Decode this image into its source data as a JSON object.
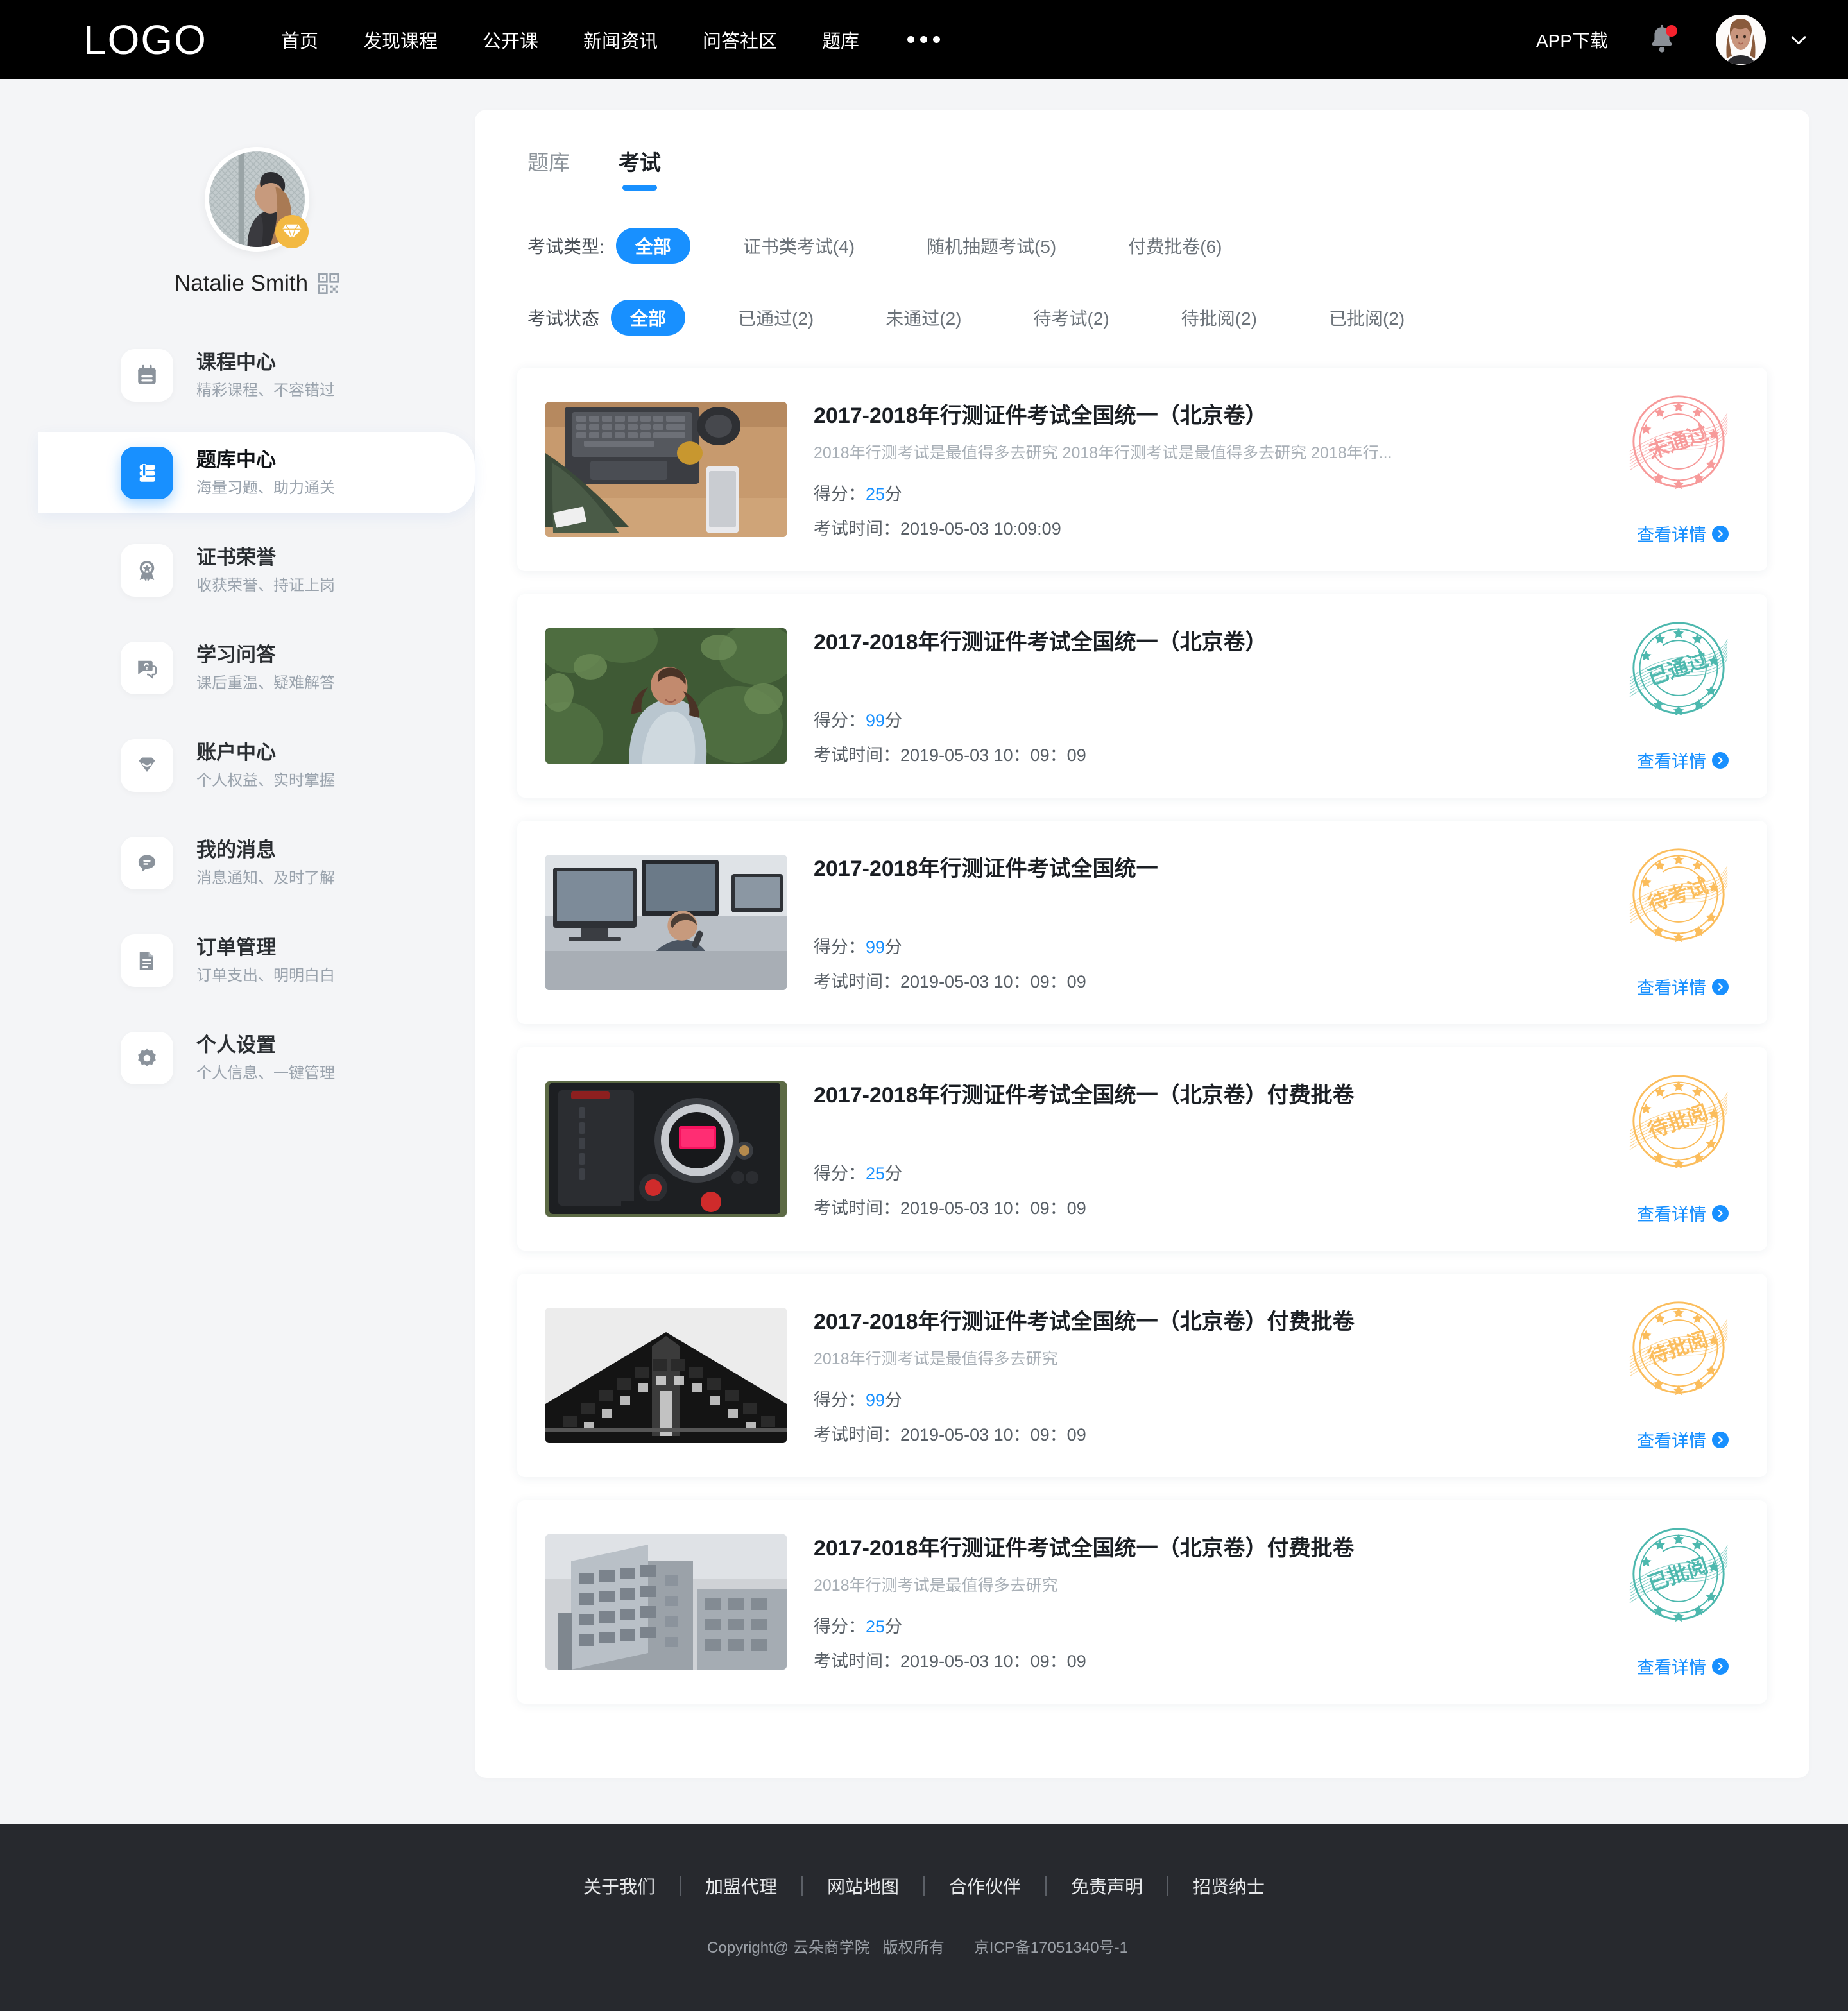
{
  "header": {
    "logo": "LOGO",
    "nav": [
      "首页",
      "发现课程",
      "公开课",
      "新闻资讯",
      "问答社区",
      "题库"
    ],
    "more_icon": "ellipsis-icon",
    "app_download": "APP下载",
    "bell_icon": "bell-icon",
    "has_notification": true,
    "avatar_icon": "user-avatar",
    "chevron_icon": "chevron-down-icon"
  },
  "sidebar": {
    "user_name": "Natalie Smith",
    "qr_icon": "qr-code-icon",
    "vip_icon": "diamond-icon",
    "menu": [
      {
        "title": "课程中心",
        "sub": "精彩课程、不容错过",
        "icon": "calendar-icon",
        "active": false
      },
      {
        "title": "题库中心",
        "sub": "海量习题、助力通关",
        "icon": "book-icon",
        "active": true
      },
      {
        "title": "证书荣誉",
        "sub": "收获荣誉、持证上岗",
        "icon": "medal-icon",
        "active": false
      },
      {
        "title": "学习问答",
        "sub": "课后重温、疑难解答",
        "icon": "question-bubble-icon",
        "active": false
      },
      {
        "title": "账户中心",
        "sub": "个人权益、实时掌握",
        "icon": "diamond-icon",
        "active": false
      },
      {
        "title": "我的消息",
        "sub": "消息通知、及时了解",
        "icon": "chat-icon",
        "active": false
      },
      {
        "title": "订单管理",
        "sub": "订单支出、明明白白",
        "icon": "document-icon",
        "active": false
      },
      {
        "title": "个人设置",
        "sub": "个人信息、一键管理",
        "icon": "gear-icon",
        "active": false
      }
    ]
  },
  "main": {
    "tabs": [
      {
        "label": "题库",
        "active": false
      },
      {
        "label": "考试",
        "active": true
      }
    ],
    "filters": [
      {
        "label": "考试类型:",
        "options": [
          {
            "label": "全部",
            "active": true
          },
          {
            "label": "证书类考试(4)",
            "active": false
          },
          {
            "label": "随机抽题考试(5)",
            "active": false
          },
          {
            "label": "付费批卷(6)",
            "active": false
          }
        ]
      },
      {
        "label": "考试状态",
        "options": [
          {
            "label": "全部",
            "active": true
          },
          {
            "label": "已通过(2)",
            "active": false
          },
          {
            "label": "未通过(2)",
            "active": false
          },
          {
            "label": "待考试(2)",
            "active": false
          },
          {
            "label": "待批阅(2)",
            "active": false
          },
          {
            "label": "已批阅(2)",
            "active": false
          }
        ]
      }
    ],
    "score_label": "得分：",
    "score_unit": "分",
    "time_label": "考试时间：",
    "detail_label": "查看详情",
    "cards": [
      {
        "title": "2017-2018年行测证件考试全国统一（北京卷）",
        "desc": "2018年行测考试是最值得多去研究 2018年行测考试是最值得多去研究 2018年行...",
        "score": "25",
        "time": "2019-05-03  10:09:09",
        "status": "未通过",
        "status_color": "#f79a9a",
        "thumb": "desk-laptop-photo"
      },
      {
        "title": "2017-2018年行测证件考试全国统一（北京卷）",
        "desc": "",
        "score": "99",
        "time": "2019-05-03  10：09：09",
        "status": "已通过",
        "status_color": "#4db8ae",
        "thumb": "woman-green-photo"
      },
      {
        "title": "2017-2018年行测证件考试全国统一",
        "desc": "",
        "score": "99",
        "time": "2019-05-03  10：09：09",
        "status": "待考试",
        "status_color": "#fbbd5c",
        "thumb": "office-desk-photo"
      },
      {
        "title": "2017-2018年行测证件考试全国统一（北京卷）付费批卷",
        "desc": "",
        "score": "25",
        "time": "2019-05-03  10：09：09",
        "status": "待批阅",
        "status_color": "#fbbd5c",
        "thumb": "camera-photo"
      },
      {
        "title": "2017-2018年行测证件考试全国统一（北京卷）付费批卷",
        "desc": "2018年行测考试是最值得多去研究",
        "score": "99",
        "time": "2019-05-03  10：09：09",
        "status": "待批阅",
        "status_color": "#fbbd5c",
        "thumb": "building-dark-photo"
      },
      {
        "title": "2017-2018年行测证件考试全国统一（北京卷）付费批卷",
        "desc": "2018年行测考试是最值得多去研究",
        "score": "25",
        "time": "2019-05-03  10：09：09",
        "status": "已批阅",
        "status_color": "#4db8ae",
        "thumb": "building-light-photo"
      }
    ]
  },
  "footer": {
    "links": [
      "关于我们",
      "加盟代理",
      "网站地图",
      "合作伙伴",
      "免责声明",
      "招贤纳士"
    ],
    "copyright": "Copyright@ 云朵商学院",
    "rights": "版权所有",
    "icp": "京ICP备17051340号-1"
  }
}
